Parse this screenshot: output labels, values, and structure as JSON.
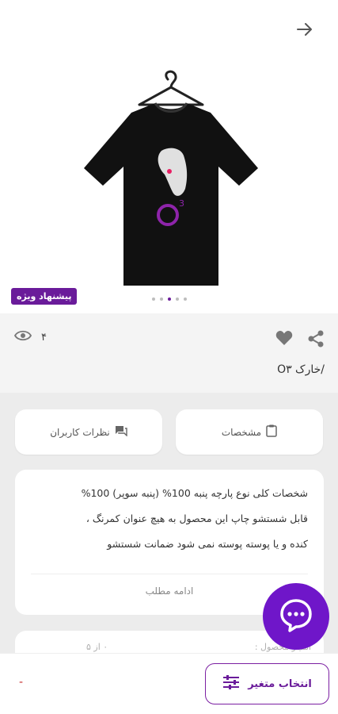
{
  "product": {
    "badge": "پیشنهاد ویژه",
    "views": "۴",
    "title": "/خارک O۳",
    "image_dots": 5,
    "active_dot": 2
  },
  "tabs": {
    "spec_label": "مشخصات",
    "reviews_label": "نظرات کاربران"
  },
  "description": {
    "line1": "شخصات کلی نوع پارچه پنبه 100% (پنبه سوپر) 100%",
    "line2": "قابل شستشو چاپ این محصول به هیچ عنوان کمرنگ ،",
    "line3": "کنده و یا پوسته پوسته نمی شود ضمانت شستشو",
    "read_more": "ادامه مطلب"
  },
  "rating": {
    "label": "امتیاز محصول :",
    "value": "۰ از ۵"
  },
  "bottom": {
    "price": "-",
    "variant_button": "انتخاب متغیر"
  },
  "print": {
    "logo_text": "O",
    "logo_sup": "3"
  },
  "colors": {
    "brand": "#6a1b9a",
    "fab": "#6f16c9"
  }
}
